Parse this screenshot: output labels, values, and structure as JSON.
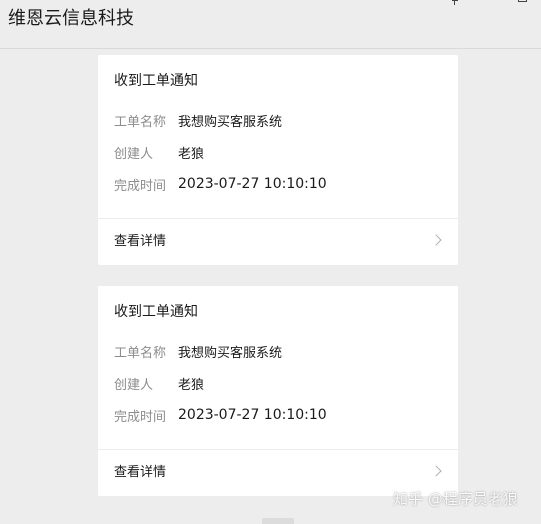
{
  "window": {
    "title": "维恩云信息科技",
    "controls": [
      "pin-icon",
      "minimize-icon",
      "maximize-icon"
    ]
  },
  "messages": [
    {
      "title": "收到工单通知",
      "fields": [
        {
          "label": "工单名称",
          "value": "我想购买客服系统"
        },
        {
          "label": "创建人",
          "value": "老狼"
        },
        {
          "label": "完成时间",
          "value": "2023-07-27 10:10:10"
        }
      ],
      "action_label": "查看详情",
      "action_icon": "chevron-right-icon"
    },
    {
      "title": "收到工单通知",
      "fields": [
        {
          "label": "工单名称",
          "value": "我想购买客服系统"
        },
        {
          "label": "创建人",
          "value": "老狼"
        },
        {
          "label": "完成时间",
          "value": "2023-07-27 10:10:10"
        }
      ],
      "action_label": "查看详情",
      "action_icon": "chevron-right-icon"
    }
  ],
  "watermark": "知乎 @程序员老狼",
  "colors": {
    "background": "#ededed",
    "card": "#ffffff",
    "label": "#8c8c8c",
    "text": "#1a1a1a",
    "divider": "#ececec"
  }
}
